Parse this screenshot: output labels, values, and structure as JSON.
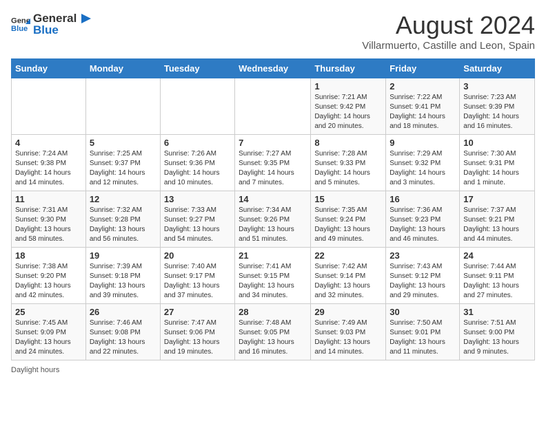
{
  "header": {
    "logo_general": "General",
    "logo_blue": "Blue",
    "month_title": "August 2024",
    "subtitle": "Villarmuerto, Castille and Leon, Spain"
  },
  "weekdays": [
    "Sunday",
    "Monday",
    "Tuesday",
    "Wednesday",
    "Thursday",
    "Friday",
    "Saturday"
  ],
  "weeks": [
    [
      {
        "day": "",
        "info": ""
      },
      {
        "day": "",
        "info": ""
      },
      {
        "day": "",
        "info": ""
      },
      {
        "day": "",
        "info": ""
      },
      {
        "day": "1",
        "info": "Sunrise: 7:21 AM\nSunset: 9:42 PM\nDaylight: 14 hours\nand 20 minutes."
      },
      {
        "day": "2",
        "info": "Sunrise: 7:22 AM\nSunset: 9:41 PM\nDaylight: 14 hours\nand 18 minutes."
      },
      {
        "day": "3",
        "info": "Sunrise: 7:23 AM\nSunset: 9:39 PM\nDaylight: 14 hours\nand 16 minutes."
      }
    ],
    [
      {
        "day": "4",
        "info": "Sunrise: 7:24 AM\nSunset: 9:38 PM\nDaylight: 14 hours\nand 14 minutes."
      },
      {
        "day": "5",
        "info": "Sunrise: 7:25 AM\nSunset: 9:37 PM\nDaylight: 14 hours\nand 12 minutes."
      },
      {
        "day": "6",
        "info": "Sunrise: 7:26 AM\nSunset: 9:36 PM\nDaylight: 14 hours\nand 10 minutes."
      },
      {
        "day": "7",
        "info": "Sunrise: 7:27 AM\nSunset: 9:35 PM\nDaylight: 14 hours\nand 7 minutes."
      },
      {
        "day": "8",
        "info": "Sunrise: 7:28 AM\nSunset: 9:33 PM\nDaylight: 14 hours\nand 5 minutes."
      },
      {
        "day": "9",
        "info": "Sunrise: 7:29 AM\nSunset: 9:32 PM\nDaylight: 14 hours\nand 3 minutes."
      },
      {
        "day": "10",
        "info": "Sunrise: 7:30 AM\nSunset: 9:31 PM\nDaylight: 14 hours\nand 1 minute."
      }
    ],
    [
      {
        "day": "11",
        "info": "Sunrise: 7:31 AM\nSunset: 9:30 PM\nDaylight: 13 hours\nand 58 minutes."
      },
      {
        "day": "12",
        "info": "Sunrise: 7:32 AM\nSunset: 9:28 PM\nDaylight: 13 hours\nand 56 minutes."
      },
      {
        "day": "13",
        "info": "Sunrise: 7:33 AM\nSunset: 9:27 PM\nDaylight: 13 hours\nand 54 minutes."
      },
      {
        "day": "14",
        "info": "Sunrise: 7:34 AM\nSunset: 9:26 PM\nDaylight: 13 hours\nand 51 minutes."
      },
      {
        "day": "15",
        "info": "Sunrise: 7:35 AM\nSunset: 9:24 PM\nDaylight: 13 hours\nand 49 minutes."
      },
      {
        "day": "16",
        "info": "Sunrise: 7:36 AM\nSunset: 9:23 PM\nDaylight: 13 hours\nand 46 minutes."
      },
      {
        "day": "17",
        "info": "Sunrise: 7:37 AM\nSunset: 9:21 PM\nDaylight: 13 hours\nand 44 minutes."
      }
    ],
    [
      {
        "day": "18",
        "info": "Sunrise: 7:38 AM\nSunset: 9:20 PM\nDaylight: 13 hours\nand 42 minutes."
      },
      {
        "day": "19",
        "info": "Sunrise: 7:39 AM\nSunset: 9:18 PM\nDaylight: 13 hours\nand 39 minutes."
      },
      {
        "day": "20",
        "info": "Sunrise: 7:40 AM\nSunset: 9:17 PM\nDaylight: 13 hours\nand 37 minutes."
      },
      {
        "day": "21",
        "info": "Sunrise: 7:41 AM\nSunset: 9:15 PM\nDaylight: 13 hours\nand 34 minutes."
      },
      {
        "day": "22",
        "info": "Sunrise: 7:42 AM\nSunset: 9:14 PM\nDaylight: 13 hours\nand 32 minutes."
      },
      {
        "day": "23",
        "info": "Sunrise: 7:43 AM\nSunset: 9:12 PM\nDaylight: 13 hours\nand 29 minutes."
      },
      {
        "day": "24",
        "info": "Sunrise: 7:44 AM\nSunset: 9:11 PM\nDaylight: 13 hours\nand 27 minutes."
      }
    ],
    [
      {
        "day": "25",
        "info": "Sunrise: 7:45 AM\nSunset: 9:09 PM\nDaylight: 13 hours\nand 24 minutes."
      },
      {
        "day": "26",
        "info": "Sunrise: 7:46 AM\nSunset: 9:08 PM\nDaylight: 13 hours\nand 22 minutes."
      },
      {
        "day": "27",
        "info": "Sunrise: 7:47 AM\nSunset: 9:06 PM\nDaylight: 13 hours\nand 19 minutes."
      },
      {
        "day": "28",
        "info": "Sunrise: 7:48 AM\nSunset: 9:05 PM\nDaylight: 13 hours\nand 16 minutes."
      },
      {
        "day": "29",
        "info": "Sunrise: 7:49 AM\nSunset: 9:03 PM\nDaylight: 13 hours\nand 14 minutes."
      },
      {
        "day": "30",
        "info": "Sunrise: 7:50 AM\nSunset: 9:01 PM\nDaylight: 13 hours\nand 11 minutes."
      },
      {
        "day": "31",
        "info": "Sunrise: 7:51 AM\nSunset: 9:00 PM\nDaylight: 13 hours\nand 9 minutes."
      }
    ]
  ],
  "footer": {
    "daylight_label": "Daylight hours"
  }
}
